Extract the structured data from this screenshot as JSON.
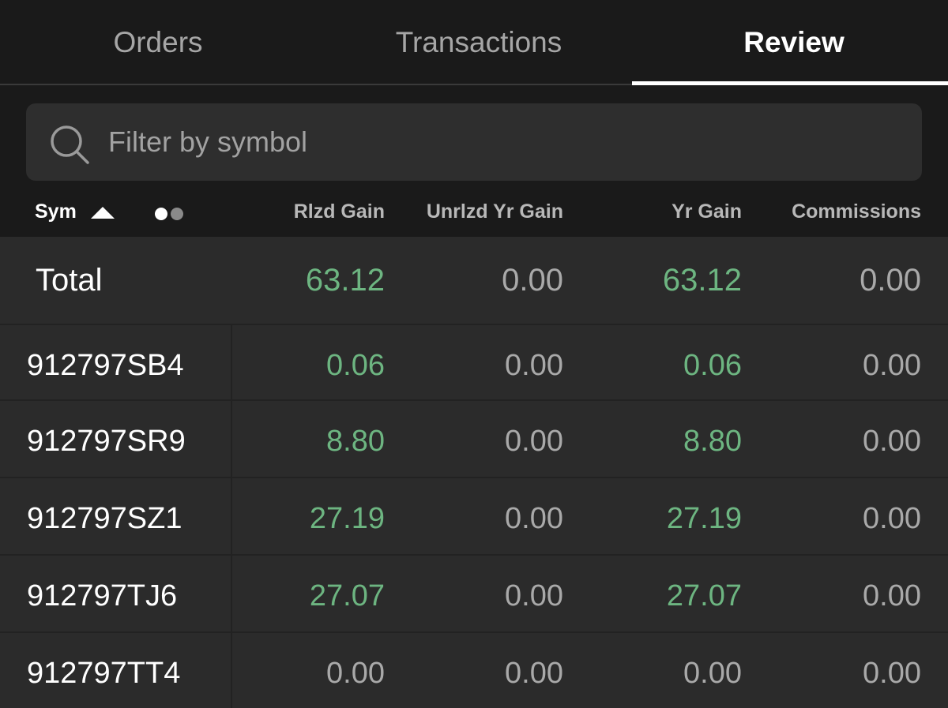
{
  "tabs": [
    {
      "label": "Orders",
      "active": false
    },
    {
      "label": "Transactions",
      "active": false
    },
    {
      "label": "Review",
      "active": true
    }
  ],
  "search": {
    "placeholder": "Filter by symbol",
    "value": ""
  },
  "columns": {
    "sym": "Sym",
    "rlzd": "Rlzd Gain",
    "unrlzd": "Unrlzd Yr Gain",
    "yr": "Yr Gain",
    "comm": "Commissions"
  },
  "sort": {
    "column": "Sym",
    "direction": "ascending"
  },
  "total": {
    "label": "Total",
    "rlzd": "63.12",
    "unrlzd": "0.00",
    "yr": "63.12",
    "comm": "0.00"
  },
  "rows": [
    {
      "sym": "912797SB4",
      "rlzd": "0.06",
      "unrlzd": "0.00",
      "yr": "0.06",
      "comm": "0.00"
    },
    {
      "sym": "912797SR9",
      "rlzd": "8.80",
      "unrlzd": "0.00",
      "yr": "8.80",
      "comm": "0.00"
    },
    {
      "sym": "912797SZ1",
      "rlzd": "27.19",
      "unrlzd": "0.00",
      "yr": "27.19",
      "comm": "0.00"
    },
    {
      "sym": "912797TJ6",
      "rlzd": "27.07",
      "unrlzd": "0.00",
      "yr": "27.07",
      "comm": "0.00"
    },
    {
      "sym": "912797TT4",
      "rlzd": "0.00",
      "unrlzd": "0.00",
      "yr": "0.00",
      "comm": "0.00"
    }
  ],
  "colors": {
    "background": "#1a1a1a",
    "row_bg": "#2b2b2b",
    "positive": "#6db581",
    "neutral": "#a9a9a9"
  }
}
